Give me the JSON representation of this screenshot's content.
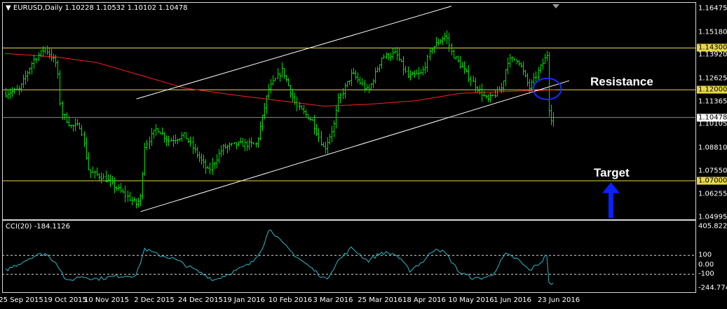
{
  "header": {
    "symbol_timeframe": "EURUSD,Daily",
    "ohlc": "1.10228 1.10532 1.10102 1.10478"
  },
  "indicator_header": "CCI(20) -184.1126",
  "annotations": {
    "resistance": "Resistance",
    "target": "Target"
  },
  "colors": {
    "background": "#000000",
    "bars": "#00e000",
    "moving_average": "#ff2020",
    "channel": "#ffffff",
    "level_line": "#e8d84a",
    "cci_line": "#2fb8c8",
    "circle": "#1a2bff",
    "arrow": "#0a22ff"
  },
  "chart_data": [
    {
      "type": "candlestick",
      "title": "EURUSD,Daily",
      "x_ticks": [
        "25 Sep 2015",
        "19 Oct 2015",
        "10 Nov 2015",
        "2 Dec 2015",
        "24 Dec 2015",
        "19 Jan 2016",
        "10 Feb 2016",
        "3 Mar 2016",
        "25 Mar 2016",
        "18 Apr 2016",
        "10 May 2016",
        "1 Jun 2016",
        "23 Jun 2016"
      ],
      "y_ticks": [
        1.04995,
        1.06255,
        1.0755,
        1.0881,
        1.10105,
        1.11365,
        1.12625,
        1.1392,
        1.1518,
        1.16475
      ],
      "ylim": [
        1.04995,
        1.16475
      ],
      "horizontal_levels": [
        {
          "price": 1.143,
          "label": "1.14300"
        },
        {
          "price": 1.12,
          "label": "1.12000"
        },
        {
          "price": 1.07,
          "label": "1.07000"
        }
      ],
      "current_price": {
        "price": 1.10478,
        "label": "1.10478"
      },
      "close_path": [
        {
          "date": "2015-09-25",
          "close": 1.118
        },
        {
          "date": "2015-10-02",
          "close": 1.12
        },
        {
          "date": "2015-10-09",
          "close": 1.136
        },
        {
          "date": "2015-10-15",
          "close": 1.143
        },
        {
          "date": "2015-10-21",
          "close": 1.134
        },
        {
          "date": "2015-10-23",
          "close": 1.108
        },
        {
          "date": "2015-10-28",
          "close": 1.1
        },
        {
          "date": "2015-11-02",
          "close": 1.1
        },
        {
          "date": "2015-11-06",
          "close": 1.075
        },
        {
          "date": "2015-11-13",
          "close": 1.072
        },
        {
          "date": "2015-11-20",
          "close": 1.066
        },
        {
          "date": "2015-11-30",
          "close": 1.057
        },
        {
          "date": "2015-12-02",
          "close": 1.061
        },
        {
          "date": "2015-12-04",
          "close": 1.089
        },
        {
          "date": "2015-12-10",
          "close": 1.099
        },
        {
          "date": "2015-12-16",
          "close": 1.092
        },
        {
          "date": "2015-12-24",
          "close": 1.095
        },
        {
          "date": "2016-01-05",
          "close": 1.075
        },
        {
          "date": "2016-01-12",
          "close": 1.088
        },
        {
          "date": "2016-01-19",
          "close": 1.09
        },
        {
          "date": "2016-01-29",
          "close": 1.09
        },
        {
          "date": "2016-02-04",
          "close": 1.12
        },
        {
          "date": "2016-02-11",
          "close": 1.131
        },
        {
          "date": "2016-02-18",
          "close": 1.111
        },
        {
          "date": "2016-02-26",
          "close": 1.103
        },
        {
          "date": "2016-03-03",
          "close": 1.087
        },
        {
          "date": "2016-03-08",
          "close": 1.101
        },
        {
          "date": "2016-03-10",
          "close": 1.114
        },
        {
          "date": "2016-03-17",
          "close": 1.129
        },
        {
          "date": "2016-03-25",
          "close": 1.119
        },
        {
          "date": "2016-04-01",
          "close": 1.138
        },
        {
          "date": "2016-04-08",
          "close": 1.14
        },
        {
          "date": "2016-04-14",
          "close": 1.127
        },
        {
          "date": "2016-04-21",
          "close": 1.129
        },
        {
          "date": "2016-04-26",
          "close": 1.143
        },
        {
          "date": "2016-05-03",
          "close": 1.15
        },
        {
          "date": "2016-05-06",
          "close": 1.14
        },
        {
          "date": "2016-05-12",
          "close": 1.131
        },
        {
          "date": "2016-05-18",
          "close": 1.122
        },
        {
          "date": "2016-05-24",
          "close": 1.114
        },
        {
          "date": "2016-05-31",
          "close": 1.121
        },
        {
          "date": "2016-06-03",
          "close": 1.136
        },
        {
          "date": "2016-06-08",
          "close": 1.137
        },
        {
          "date": "2016-06-14",
          "close": 1.121
        },
        {
          "date": "2016-06-17",
          "close": 1.127
        },
        {
          "date": "2016-06-23",
          "close": 1.14
        },
        {
          "date": "2016-06-24",
          "close": 1.104
        },
        {
          "date": "2016-06-27",
          "close": 1.105
        }
      ],
      "moving_average": [
        {
          "date": "2015-09-25",
          "value": 1.14
        },
        {
          "date": "2015-10-21",
          "value": 1.138
        },
        {
          "date": "2015-11-10",
          "value": 1.135
        },
        {
          "date": "2015-12-02",
          "value": 1.128
        },
        {
          "date": "2015-12-24",
          "value": 1.121
        },
        {
          "date": "2016-01-19",
          "value": 1.117
        },
        {
          "date": "2016-02-10",
          "value": 1.114
        },
        {
          "date": "2016-03-03",
          "value": 1.111
        },
        {
          "date": "2016-03-25",
          "value": 1.112
        },
        {
          "date": "2016-04-18",
          "value": 1.114
        },
        {
          "date": "2016-05-10",
          "value": 1.118
        },
        {
          "date": "2016-06-01",
          "value": 1.119
        },
        {
          "date": "2016-06-27",
          "value": 1.12
        }
      ],
      "channel_lines": [
        {
          "from": {
            "date": "2015-11-30",
            "price": 1.115
          },
          "to": {
            "date": "2016-05-06",
            "price": 1.166
          }
        },
        {
          "from": {
            "date": "2015-12-02",
            "price": 1.053
          },
          "to": {
            "date": "2016-07-04",
            "price": 1.125
          }
        }
      ]
    },
    {
      "type": "line",
      "title": "CCI(20) -184.1126",
      "y_ticks": [
        "405.8221",
        "100",
        "0.00",
        "-100",
        "-244.7742"
      ],
      "ylim": [
        -244.7742,
        405.8221
      ],
      "dashed_levels": [
        100,
        -100
      ],
      "series": [
        {
          "values": [
            {
              "date": "2015-09-25",
              "value": -60
            },
            {
              "date": "2015-10-02",
              "value": 10
            },
            {
              "date": "2015-10-09",
              "value": 90
            },
            {
              "date": "2015-10-15",
              "value": 120
            },
            {
              "date": "2015-10-21",
              "value": 20
            },
            {
              "date": "2015-10-26",
              "value": -180
            },
            {
              "date": "2015-11-02",
              "value": -120
            },
            {
              "date": "2015-11-10",
              "value": -150
            },
            {
              "date": "2015-11-20",
              "value": -120
            },
            {
              "date": "2015-11-30",
              "value": -110
            },
            {
              "date": "2015-12-04",
              "value": 170
            },
            {
              "date": "2015-12-10",
              "value": 110
            },
            {
              "date": "2015-12-18",
              "value": 70
            },
            {
              "date": "2015-12-28",
              "value": -40
            },
            {
              "date": "2016-01-08",
              "value": -160
            },
            {
              "date": "2016-01-19",
              "value": -60
            },
            {
              "date": "2016-01-27",
              "value": 20
            },
            {
              "date": "2016-02-01",
              "value": 180
            },
            {
              "date": "2016-02-05",
              "value": 390
            },
            {
              "date": "2016-02-10",
              "value": 250
            },
            {
              "date": "2016-02-18",
              "value": 90
            },
            {
              "date": "2016-02-26",
              "value": -40
            },
            {
              "date": "2016-03-04",
              "value": -160
            },
            {
              "date": "2016-03-10",
              "value": 40
            },
            {
              "date": "2016-03-17",
              "value": 180
            },
            {
              "date": "2016-03-25",
              "value": 40
            },
            {
              "date": "2016-04-01",
              "value": 130
            },
            {
              "date": "2016-04-08",
              "value": 110
            },
            {
              "date": "2016-04-15",
              "value": -60
            },
            {
              "date": "2016-04-22",
              "value": 40
            },
            {
              "date": "2016-04-28",
              "value": 180
            },
            {
              "date": "2016-05-03",
              "value": 120
            },
            {
              "date": "2016-05-10",
              "value": -80
            },
            {
              "date": "2016-05-18",
              "value": -150
            },
            {
              "date": "2016-05-26",
              "value": -120
            },
            {
              "date": "2016-06-02",
              "value": 110
            },
            {
              "date": "2016-06-08",
              "value": 60
            },
            {
              "date": "2016-06-14",
              "value": -60
            },
            {
              "date": "2016-06-20",
              "value": 30
            },
            {
              "date": "2016-06-23",
              "value": 120
            },
            {
              "date": "2016-06-24",
              "value": -240
            },
            {
              "date": "2016-06-27",
              "value": -184
            }
          ]
        }
      ]
    }
  ]
}
